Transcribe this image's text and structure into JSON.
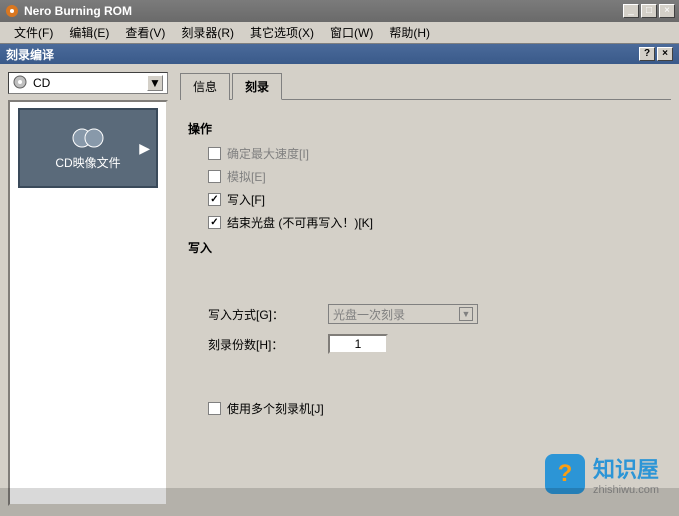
{
  "window": {
    "title": "Nero Burning ROM"
  },
  "menubar": [
    {
      "label": "文件(F)"
    },
    {
      "label": "编辑(E)"
    },
    {
      "label": "查看(V)"
    },
    {
      "label": "刻录器(R)"
    },
    {
      "label": "其它选项(X)"
    },
    {
      "label": "窗口(W)"
    },
    {
      "label": "帮助(H)"
    }
  ],
  "dialog": {
    "title": "刻录编译"
  },
  "combo": {
    "value": "CD"
  },
  "sidebar": {
    "items": [
      {
        "label": "CD映像文件"
      }
    ]
  },
  "tabs": [
    {
      "label": "信息"
    },
    {
      "label": "刻录"
    }
  ],
  "section_action": "操作",
  "checkboxes": {
    "max_speed": {
      "label": "确定最大速度[I]",
      "checked": false,
      "enabled": false
    },
    "simulate": {
      "label": "模拟[E]",
      "checked": false,
      "enabled": false
    },
    "write": {
      "label": "写入[F]",
      "checked": true,
      "enabled": true
    },
    "finalize": {
      "label": "结束光盘 (不可再写入！)[K]",
      "checked": true,
      "enabled": true
    },
    "multi_burner": {
      "label": "使用多个刻录机[J]",
      "checked": false,
      "enabled": true
    }
  },
  "section_write": "写入",
  "write_mode": {
    "label": "写入方式[G]：",
    "value": "光盘一次刻录"
  },
  "copies": {
    "label": "刻录份数[H]：",
    "value": "1"
  },
  "watermark": {
    "title": "知识屋",
    "sub": "zhishiwu.com",
    "icon": "?"
  }
}
